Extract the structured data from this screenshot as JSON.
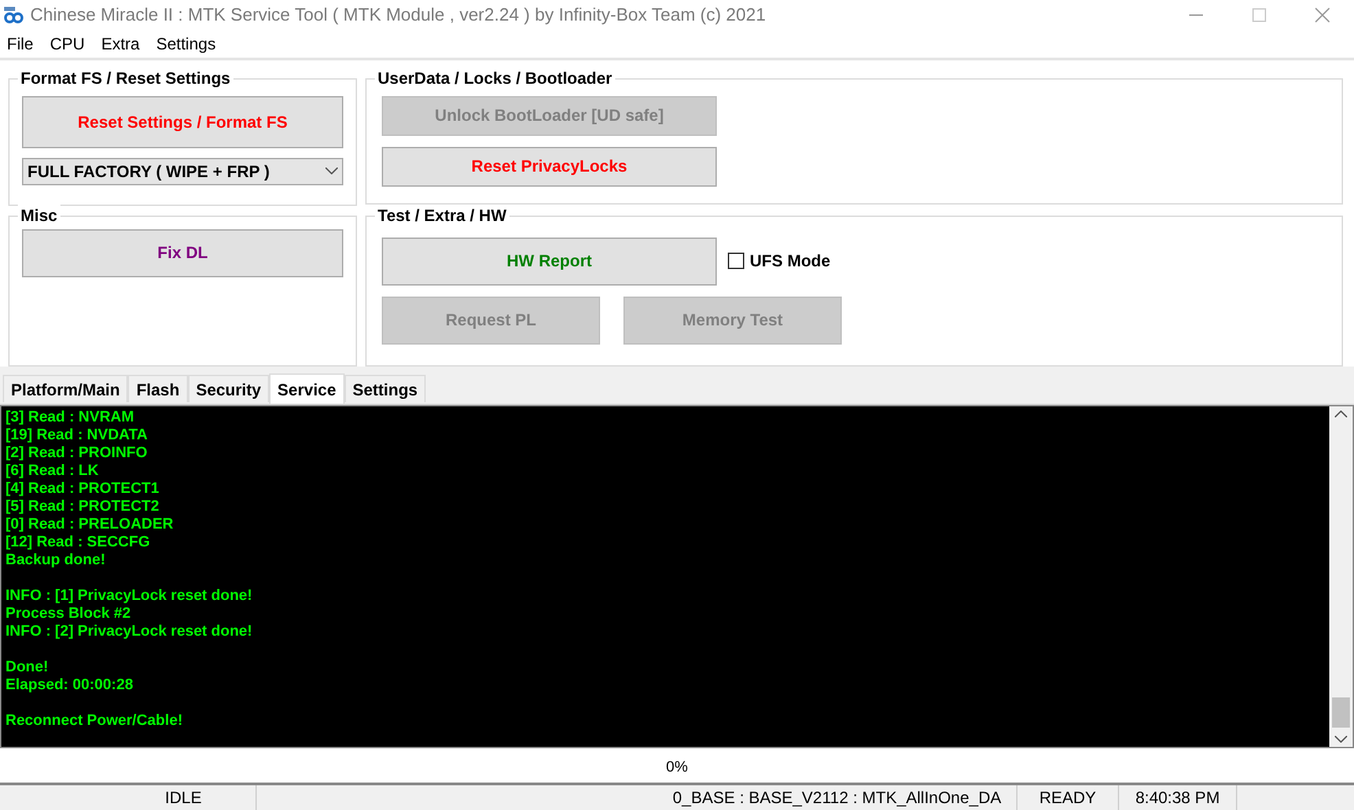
{
  "window": {
    "title": "Chinese Miracle II : MTK Service Tool ( MTK Module , ver2.24  ) by Infinity-Box Team (c) 2021"
  },
  "menu": [
    "File",
    "CPU",
    "Extra",
    "Settings"
  ],
  "groups": [
    {
      "title": "Format FS / Reset Settings",
      "buttons": [
        {
          "label": "Reset Settings / Format FS",
          "disabled": false,
          "color": "#ff0000"
        }
      ],
      "dropdown": {
        "value": "FULL FACTORY ( WIPE + FRP )"
      }
    },
    {
      "title": "UserData /  Locks  / Bootloader",
      "buttons": [
        {
          "label": "Unlock BootLoader [UD safe]",
          "disabled": true,
          "color": "#808080"
        },
        {
          "label": "Reset PrivacyLocks",
          "disabled": false,
          "color": "#ff0000"
        }
      ]
    },
    {
      "title": "Misc",
      "buttons": [
        {
          "label": "Fix DL",
          "disabled": false,
          "color": "#800080"
        }
      ]
    },
    {
      "title": "Test / Extra / HW",
      "buttons": [
        {
          "label": "HW Report",
          "disabled": false,
          "color": "#008000"
        },
        {
          "label": "Request PL",
          "disabled": true,
          "color": "#808080"
        },
        {
          "label": "Memory Test",
          "disabled": true,
          "color": "#808080"
        }
      ],
      "checkbox": {
        "label": "UFS Mode",
        "checked": false
      }
    }
  ],
  "tabs": [
    {
      "label": "Platform/Main",
      "selected": false
    },
    {
      "label": "Flash",
      "selected": false
    },
    {
      "label": "Security",
      "selected": false
    },
    {
      "label": "Service",
      "selected": true
    },
    {
      "label": "Settings",
      "selected": false
    }
  ],
  "console": [
    {
      "lines": [
        "[3] Read : NVRAM",
        "[19] Read : NVDATA",
        "[2] Read : PROINFO",
        "[6] Read : LK",
        "[4] Read : PROTECT1",
        "[5] Read : PROTECT2",
        "[0] Read : PRELOADER",
        "[12] Read : SECCFG",
        "Backup done!"
      ]
    },
    {
      "lines": [
        "INFO : [1] PrivacyLock reset done!",
        "Process Block #2",
        "INFO : [2] PrivacyLock reset done!"
      ]
    },
    {
      "lines": [
        "Done!",
        "Elapsed: 00:00:28"
      ]
    },
    {
      "lines": [
        "Reconnect Power/Cable!"
      ]
    }
  ],
  "progress": {
    "label": "0%",
    "level": 0
  },
  "status_bar": [
    "IDLE",
    "0_BASE : BASE_V2112 : MTK_AllInOne_DA",
    "READY",
    "8:40:38 PM"
  ]
}
